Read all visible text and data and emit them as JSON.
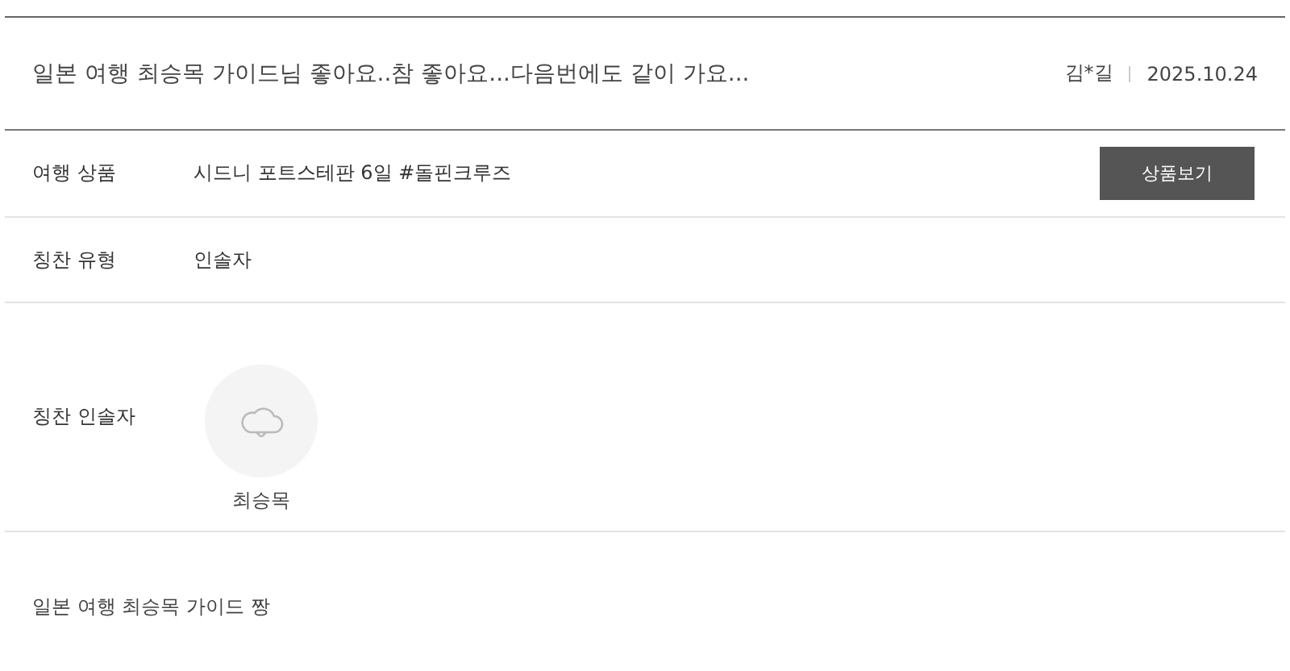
{
  "post": {
    "title": "일본 여행 최승목 가이드님 좋아요..참 좋아요...다음번에도 같이 가요...",
    "author": "김*길",
    "date": "2025.10.24"
  },
  "rows": [
    {
      "kind": "product",
      "label": "여행 상품",
      "value": "시드니 포트스테판 6일 #돌핀크루즈",
      "button": "상품보기"
    },
    {
      "kind": "text",
      "label": "칭찬 유형",
      "value": "인솔자"
    },
    {
      "kind": "person",
      "label": "칭찬 인솔자",
      "name": "최승목"
    }
  ],
  "body": "일본 여행 최승목 가이드 짱"
}
